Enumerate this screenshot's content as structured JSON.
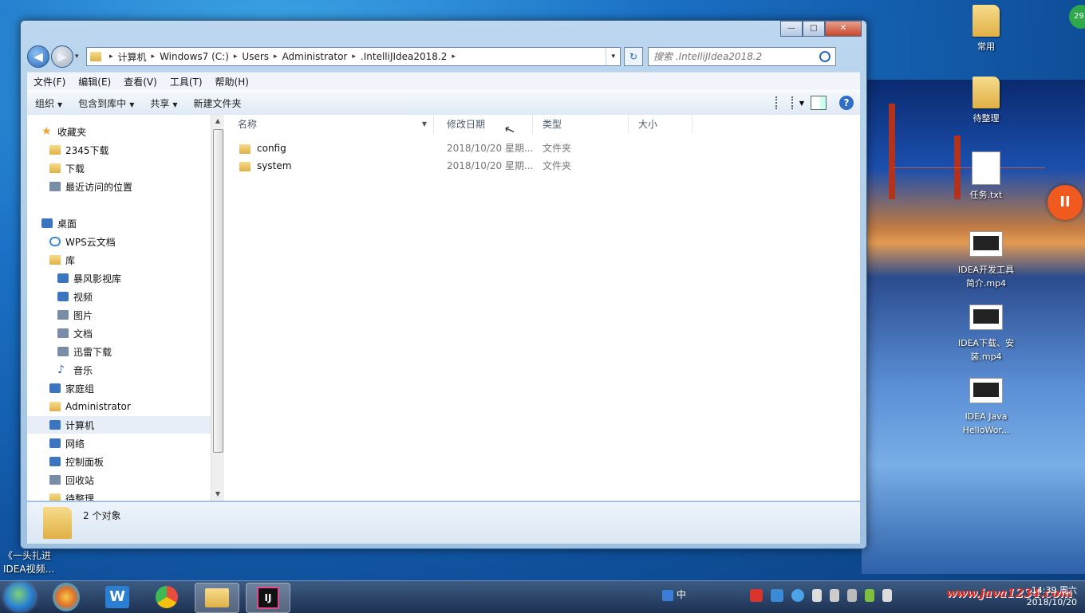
{
  "desktop": {
    "icons": [
      {
        "label": "常用",
        "kind": "folder"
      },
      {
        "label": "待整理",
        "kind": "folder"
      },
      {
        "label": "任务.txt",
        "kind": "doc"
      },
      {
        "label": "IDEA开发工具简介.mp4",
        "kind": "video"
      },
      {
        "label": "IDEA下载、安装.mp4",
        "kind": "video"
      },
      {
        "label": "IDEA  Java HelloWor...",
        "kind": "video"
      }
    ],
    "left_labels": [
      "《一头扎进",
      "IDEA视频..."
    ],
    "corner_badge": "29",
    "pause_symbol": "II"
  },
  "window": {
    "caption": {
      "min": "—",
      "max": "□",
      "close": "✕"
    },
    "nav": {
      "back": "◀",
      "forward": "▶"
    },
    "address": {
      "crumbs": [
        "计算机",
        "Windows7 (C:)",
        "Users",
        "Administrator",
        ".IntelliJIdea2018.2"
      ],
      "separator": "▸",
      "dropdown": "▾"
    },
    "search": {
      "placeholder": "搜索 .IntelliJIdea2018.2"
    },
    "menu": [
      "文件(F)",
      "编辑(E)",
      "查看(V)",
      "工具(T)",
      "帮助(H)"
    ],
    "toolbar": {
      "organize": "组织",
      "include_library": "包含到库中",
      "share": "共享",
      "new_folder": "新建文件夹",
      "help": "?"
    },
    "nav_pane": {
      "items": [
        {
          "label": "收藏夹",
          "icon": "star-icon",
          "indent": 0
        },
        {
          "label": "2345下载",
          "icon": "folder-icon",
          "indent": 1
        },
        {
          "label": "下载",
          "icon": "download-folder-icon",
          "indent": 1
        },
        {
          "label": "最近访问的位置",
          "icon": "recent-places-icon",
          "indent": 1
        },
        {
          "label": "桌面",
          "icon": "desktop-icon",
          "indent": 0
        },
        {
          "label": "WPS云文档",
          "icon": "cloud-icon",
          "indent": 1
        },
        {
          "label": "库",
          "icon": "library-icon",
          "indent": 1
        },
        {
          "label": "暴风影视库",
          "icon": "video-library-icon",
          "indent": 2
        },
        {
          "label": "视频",
          "icon": "video-icon",
          "indent": 2
        },
        {
          "label": "图片",
          "icon": "picture-icon",
          "indent": 2
        },
        {
          "label": "文档",
          "icon": "document-icon",
          "indent": 2
        },
        {
          "label": "迅雷下载",
          "icon": "thunder-download-icon",
          "indent": 2
        },
        {
          "label": "音乐",
          "icon": "music-icon",
          "indent": 2
        },
        {
          "label": "家庭组",
          "icon": "homegroup-icon",
          "indent": 1
        },
        {
          "label": "Administrator",
          "icon": "user-folder-icon",
          "indent": 1
        },
        {
          "label": "计算机",
          "icon": "computer-icon",
          "indent": 1,
          "selected": true
        },
        {
          "label": "网络",
          "icon": "network-icon",
          "indent": 1
        },
        {
          "label": "控制面板",
          "icon": "control-panel-icon",
          "indent": 1
        },
        {
          "label": "回收站",
          "icon": "recycle-bin-icon",
          "indent": 1
        },
        {
          "label": "待整理",
          "icon": "folder-icon",
          "indent": 1
        }
      ]
    },
    "columns": [
      "名称",
      "修改日期",
      "类型",
      "大小"
    ],
    "files": [
      {
        "name": "config",
        "date": "2018/10/20 星期...",
        "type": "文件夹",
        "size": ""
      },
      {
        "name": "system",
        "date": "2018/10/20 星期...",
        "type": "文件夹",
        "size": ""
      }
    ],
    "status": {
      "count": "2 个对象"
    }
  },
  "taskbar": {
    "apps": [
      "WPS",
      "Chrome",
      "Explorer",
      "IntelliJ IDEA"
    ],
    "ime": "中",
    "time": "14:39 周六",
    "date": "2018/10/20",
    "watermark": "www.java1234.com"
  },
  "colors": {
    "accent": "#2a66b8",
    "selected_bg": "#e7eef7",
    "watermark": "#e8261b"
  }
}
